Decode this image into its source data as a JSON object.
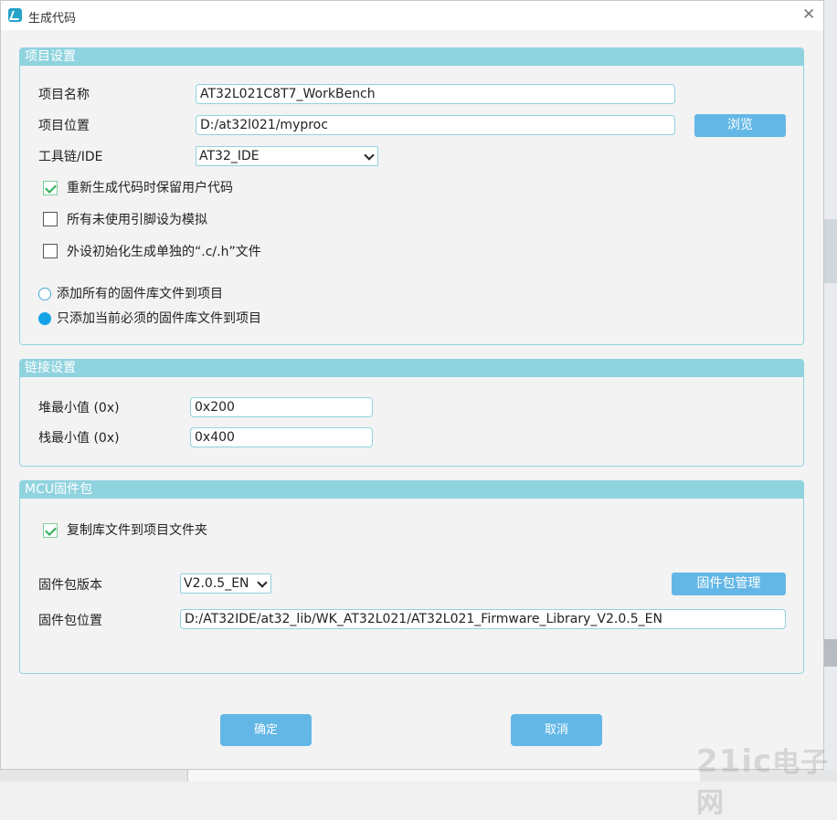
{
  "window": {
    "title": "生成代码",
    "close_glyph": "✕"
  },
  "project_settings": {
    "header": "项目设置",
    "name_label": "项目名称",
    "name_value": "AT32L021C8T7_WorkBench",
    "location_label": "项目位置",
    "location_value": "D:/at32l021/myproc",
    "browse_label": "浏览",
    "toolchain_label": "工具链/IDE",
    "toolchain_value": "AT32_IDE",
    "checkboxes": [
      {
        "label": "重新生成代码时保留用户代码",
        "checked": true
      },
      {
        "label": "所有未使用引脚设为模拟",
        "checked": false
      },
      {
        "label": "外设初始化生成单独的“.c/.h”文件",
        "checked": false
      }
    ],
    "radios": [
      {
        "label": "添加所有的固件库文件到项目",
        "selected": false
      },
      {
        "label": "只添加当前必须的固件库文件到项目",
        "selected": true
      }
    ]
  },
  "link_settings": {
    "header": "链接设置",
    "heap_label": "堆最小值 (0x)",
    "heap_value": "0x200",
    "stack_label": "栈最小值 (0x)",
    "stack_value": "0x400"
  },
  "mcu_package": {
    "header": "MCU固件包",
    "copy_label": "复制库文件到项目文件夹",
    "copy_checked": true,
    "version_label": "固件包版本",
    "version_value": "V2.0.5_EN",
    "manage_label": "固件包管理",
    "location_label": "固件包位置",
    "location_value": "D:/AT32IDE/at32_lib/WK_AT32L021/AT32L021_Firmware_Library_V2.0.5_EN"
  },
  "footer": {
    "ok_label": "确定",
    "cancel_label": "取消"
  },
  "watermark": {
    "brand": "21ic",
    "suffix": "电子网"
  },
  "colors": {
    "accent": "#8fd3df",
    "button": "#63b7e6",
    "radio_selected": "#14a3e6",
    "check": "#2fae5a"
  }
}
